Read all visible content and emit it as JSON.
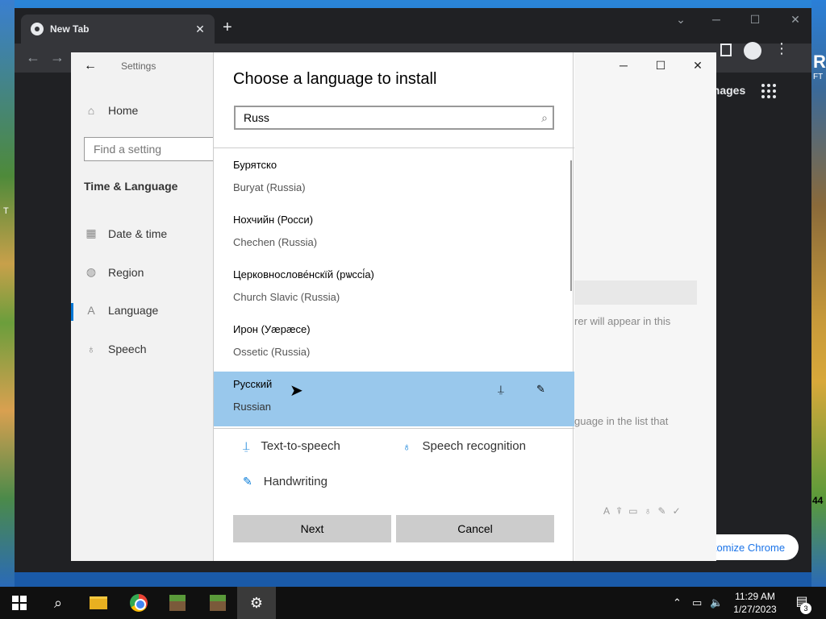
{
  "browser": {
    "tab_title": "New Tab",
    "tab_close": "✕",
    "new_tab": "+",
    "images_link": "Images",
    "customize_button": "tomize Chrome",
    "background_text": {
      "right_letter": "R",
      "right_small": "FT",
      "right_number": "44",
      "left_letter": "T"
    }
  },
  "settings": {
    "title": "Settings",
    "search_placeholder": "Find a setting",
    "section": "Time & Language",
    "nav": [
      {
        "label": "Home",
        "icon": "home-icon"
      },
      {
        "label": "Date & time",
        "icon": "calendar-clock-icon"
      },
      {
        "label": "Region",
        "icon": "globe-icon"
      },
      {
        "label": "Language",
        "icon": "language-icon"
      },
      {
        "label": "Speech",
        "icon": "microphone-icon"
      }
    ],
    "main_text_1": "rer will appear in this",
    "main_text_2": "guage in the list that"
  },
  "dialog": {
    "title": "Choose a language to install",
    "search_value": "Russ",
    "languages": [
      {
        "native": "Бурятско",
        "english": "Buryat (Russia)"
      },
      {
        "native": "Нохчийн (Росси)",
        "english": "Chechen (Russia)"
      },
      {
        "native": "Церковнослове́нскїй (рѡссі́а)",
        "english": "Church Slavic (Russia)"
      },
      {
        "native": "Ирон (Уæрæсе)",
        "english": "Ossetic (Russia)"
      },
      {
        "native": "Русский",
        "english": "Russian"
      }
    ],
    "features": {
      "tts": "Text-to-speech",
      "speech": "Speech recognition",
      "handwriting": "Handwriting"
    },
    "next_button": "Next",
    "cancel_button": "Cancel"
  },
  "taskbar": {
    "time": "11:29 AM",
    "date": "1/27/2023",
    "notification_count": "3"
  }
}
